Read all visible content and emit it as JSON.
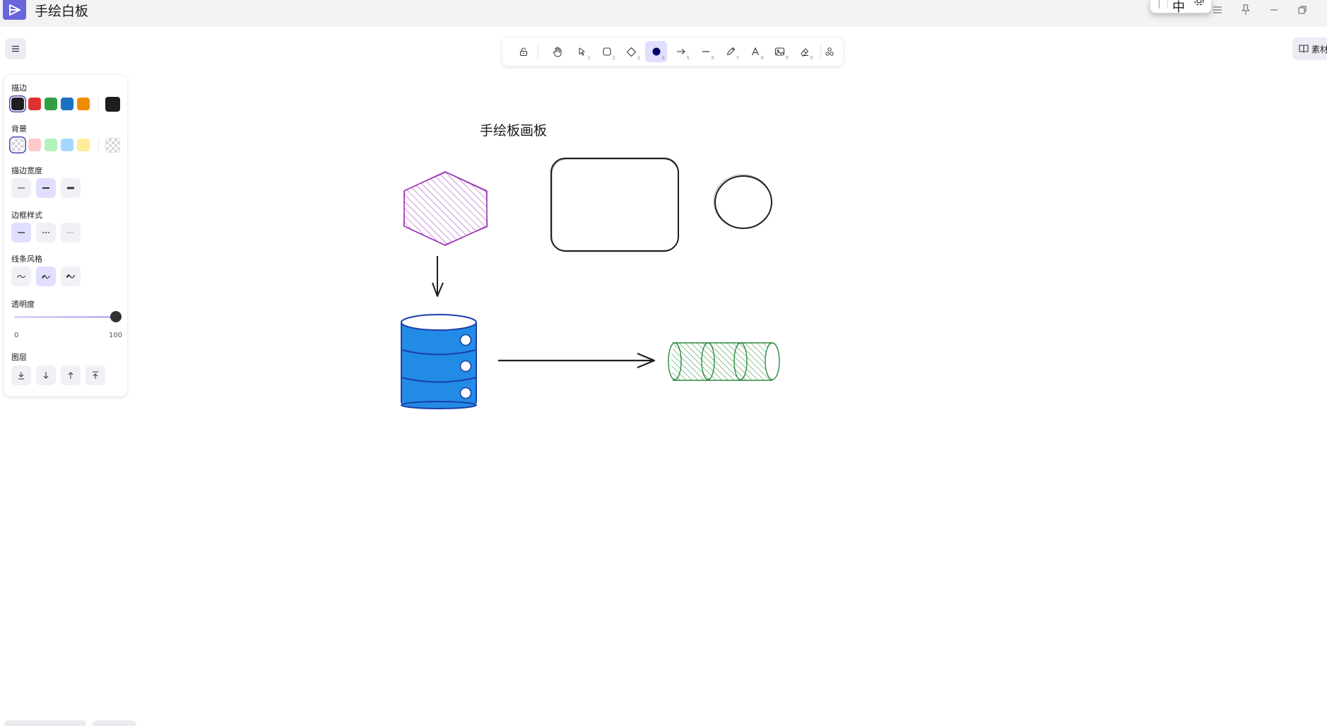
{
  "app": {
    "title": "手绘白板"
  },
  "ime": {
    "mode_label": "中"
  },
  "toolbar": {
    "tools": [
      {
        "name": "lock",
        "shortcut": ""
      },
      {
        "name": "hand",
        "shortcut": ""
      },
      {
        "name": "selection",
        "shortcut": "1"
      },
      {
        "name": "rectangle",
        "shortcut": "2"
      },
      {
        "name": "diamond",
        "shortcut": "3"
      },
      {
        "name": "ellipse",
        "shortcut": "4",
        "active": true
      },
      {
        "name": "arrow",
        "shortcut": "5"
      },
      {
        "name": "line",
        "shortcut": "6"
      },
      {
        "name": "draw",
        "shortcut": "7"
      },
      {
        "name": "text",
        "shortcut": "8"
      },
      {
        "name": "image",
        "shortcut": "9"
      },
      {
        "name": "eraser",
        "shortcut": "0"
      },
      {
        "name": "extra-tools",
        "shortcut": ""
      }
    ]
  },
  "library": {
    "label": "素材"
  },
  "panel": {
    "stroke_label": "描边",
    "stroke_colors": [
      "#1e1e1e",
      "#e03131",
      "#2f9e44",
      "#1971c2",
      "#f08c00"
    ],
    "stroke_current": "#1e1e1e",
    "background_label": "背景",
    "background_colors": [
      "transparent",
      "#ffc9c9",
      "#b2f2bb",
      "#a5d8ff",
      "#ffec99"
    ],
    "background_current": "transparent",
    "stroke_width_label": "描边宽度",
    "stroke_style_label": "边框样式",
    "sloppiness_label": "线条风格",
    "opacity_label": "透明度",
    "opacity_min": "0",
    "opacity_max": "100",
    "opacity_value": 100,
    "layers_label": "图层"
  },
  "canvas": {
    "title": "手绘板画板",
    "colors": {
      "hexagon": "#9c36b5",
      "database_fill": "#228be6",
      "database_stroke": "#1c3faa",
      "cylinder": "#2b8a3e",
      "ink": "#1e1e1e"
    }
  }
}
